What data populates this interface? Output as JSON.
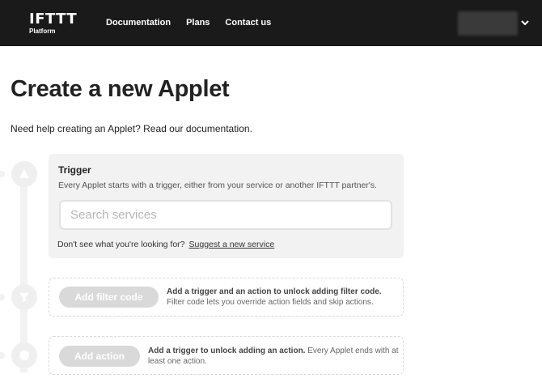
{
  "header": {
    "logo_main": "IFTTT",
    "logo_sub": "Platform",
    "nav": [
      "Documentation",
      "Plans",
      "Contact us"
    ]
  },
  "page": {
    "title": "Create a new Applet",
    "help_prefix": "Need help creating an Applet? Read ",
    "help_link": "our documentation",
    "help_suffix": "."
  },
  "trigger": {
    "title": "Trigger",
    "description": "Every Applet starts with a trigger, either from your service or another IFTTT partner's.",
    "search_placeholder": "Search services",
    "no_find_text": "Don't see what you're looking for?",
    "suggest_link": "Suggest a new service"
  },
  "filter": {
    "button": "Add filter code",
    "bold_text": "Add a trigger and an action to unlock adding filter code.",
    "text": "Filter code lets you override action fields and skip actions."
  },
  "action": {
    "button": "Add action",
    "bold_text": "Add a trigger to unlock adding an action.",
    "text": "Every Applet ends with at least one action."
  },
  "colors": {
    "header_bg": "#1a1a1a",
    "card_bg": "#f2f2f2",
    "disabled_button": "#d9d9d9"
  }
}
